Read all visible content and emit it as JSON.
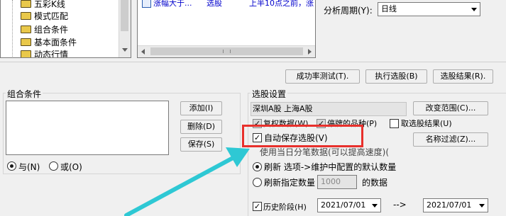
{
  "tree": {
    "items": [
      {
        "label": "五彩K线"
      },
      {
        "label": "模式匹配"
      },
      {
        "label": "组合条件"
      },
      {
        "label": "基本面条件"
      },
      {
        "label": "动态行情"
      }
    ]
  },
  "formula_list": {
    "row": {
      "name": "涨幅大于...",
      "type": "选股",
      "desc": "上半10点之前，涨"
    }
  },
  "period": {
    "label": "分析周期(Y):",
    "value": "日线"
  },
  "actions": {
    "success_test": "成功率测试(T).",
    "run_select": "执行选股(B)",
    "select_result": "选股结果(R)."
  },
  "combo": {
    "title": "组合条件",
    "add": "添加(I)",
    "delete": "删除(D)",
    "save": "保存(S)",
    "and_label": "与(N)",
    "or_label": "或(O)"
  },
  "settings": {
    "title": "选股设置",
    "scope_text": "深圳A股  上海A股",
    "change_scope": "改变范围(C)...",
    "adj_data": "复权数据(W)",
    "suspended": "停牌的品种(P)",
    "to_board": "取选股结果(U)",
    "auto_save": "自动保存选股(V)",
    "name_filter": "名称过滤(Z)...",
    "today_data": "使用当日分笔数据(可以提高速度)(",
    "refresh_label": "刷新 选项->维护中配置的默认数量",
    "refresh_count_label": "刷新指定数量",
    "refresh_count_value": "1000",
    "refresh_suffix": "的数据",
    "history_label": "历史阶段(H)",
    "date_from": "2021/07/01",
    "arrow": "-->",
    "date_to": "2021/07/01"
  },
  "colors": {
    "highlight_box": "#e8302c",
    "annotation_arrow": "#2ec8d4",
    "link_blue": "#0000cc"
  }
}
